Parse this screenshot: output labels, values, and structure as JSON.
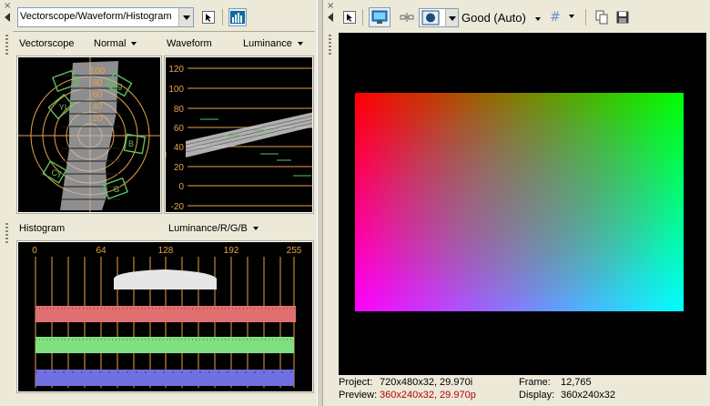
{
  "left": {
    "scope_select_value": "Vectorscope/Waveform/Histogram",
    "vectorscope": {
      "label": "Vectorscope",
      "mode": "Normal",
      "rings": [
        "100",
        "80",
        "60",
        "40",
        "20"
      ],
      "targets": [
        "R",
        "Mg",
        "YI",
        "B",
        "Cy",
        "G"
      ]
    },
    "waveform": {
      "label": "Waveform",
      "mode": "Luminance",
      "ticks": [
        "120",
        "100",
        "80",
        "60",
        "40",
        "20",
        "0",
        "-20"
      ]
    },
    "histogram": {
      "label": "Histogram",
      "mode": "Luminance/R/G/B",
      "ticks": [
        "0",
        "64",
        "128",
        "192",
        "255"
      ]
    }
  },
  "right": {
    "quality_value": "Good (Auto)",
    "status": {
      "project_label": "Project:",
      "project_value": "720x480x32, 29.970i",
      "preview_label": "Preview:",
      "preview_value": "360x240x32, 29.970p",
      "frame_label": "Frame:",
      "frame_value": "12,765",
      "display_label": "Display:",
      "display_value": "360x240x32"
    }
  },
  "icons": {
    "close": "×",
    "collapse": "left-triangle"
  },
  "colors": {
    "scope_lines": "#e8a14b",
    "trace": "#60c060",
    "hist_red": "#e07070",
    "hist_green": "#80e080",
    "hist_blue": "#7070e0",
    "preview_error": "#b5000a"
  }
}
